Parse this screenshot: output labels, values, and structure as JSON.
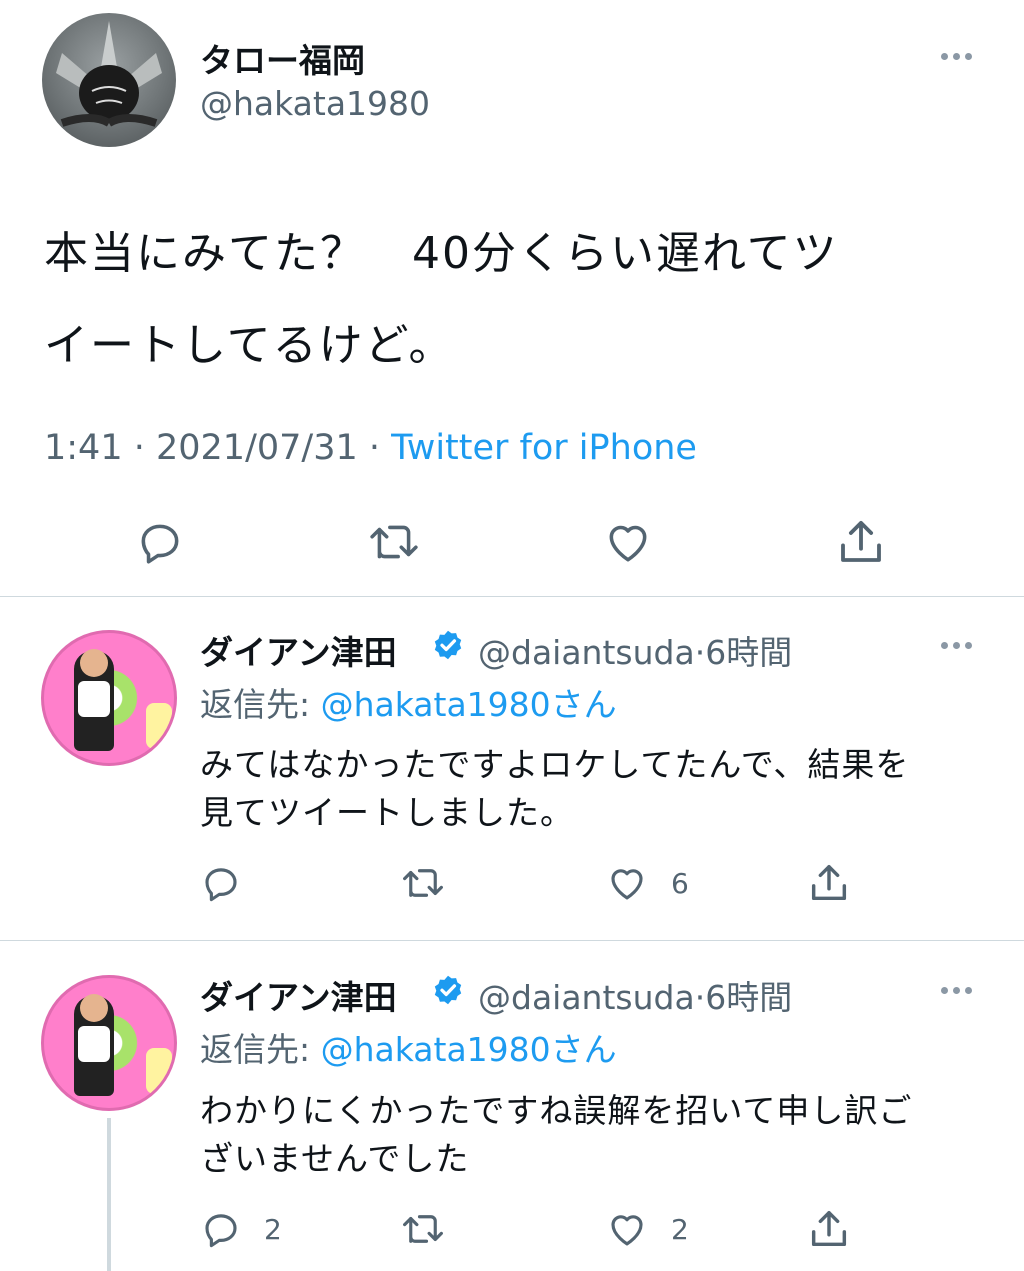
{
  "main_tweet": {
    "display_name": "タロー福岡",
    "handle": "@hakata1980",
    "text_line1": "本当にみてた？　40分くらい遅れてツ",
    "text_line2": "イートしてるけど。",
    "time": "1:41",
    "date": "2021/07/31",
    "separator": " · ",
    "source": "Twitter for iPhone"
  },
  "replies": [
    {
      "display_name": "ダイアン津田",
      "handle": "@daiantsuda",
      "dot": "·",
      "time": "6時間",
      "reply_label": "返信先: ",
      "reply_to": "@hakata1980さん",
      "text_line1": "みてはなかったですよロケしてたんで、結果を",
      "text_line2": "見てツイートしました。",
      "reply_count": "",
      "like_count": "6"
    },
    {
      "display_name": "ダイアン津田",
      "handle": "@daiantsuda",
      "dot": "·",
      "time": "6時間",
      "reply_label": "返信先: ",
      "reply_to": "@hakata1980さん",
      "text_line1": "わかりにくかったですね誤解を招いて申し訳ご",
      "text_line2": "ざいませんでした",
      "reply_count": "2",
      "like_count": "2"
    }
  ],
  "icons": [
    "more-icon",
    "reply-icon",
    "retweet-icon",
    "like-icon",
    "share-icon",
    "verified-icon"
  ],
  "colors": {
    "accent": "#1d9bf0",
    "muted": "#536471",
    "divider": "#cfd9de"
  }
}
